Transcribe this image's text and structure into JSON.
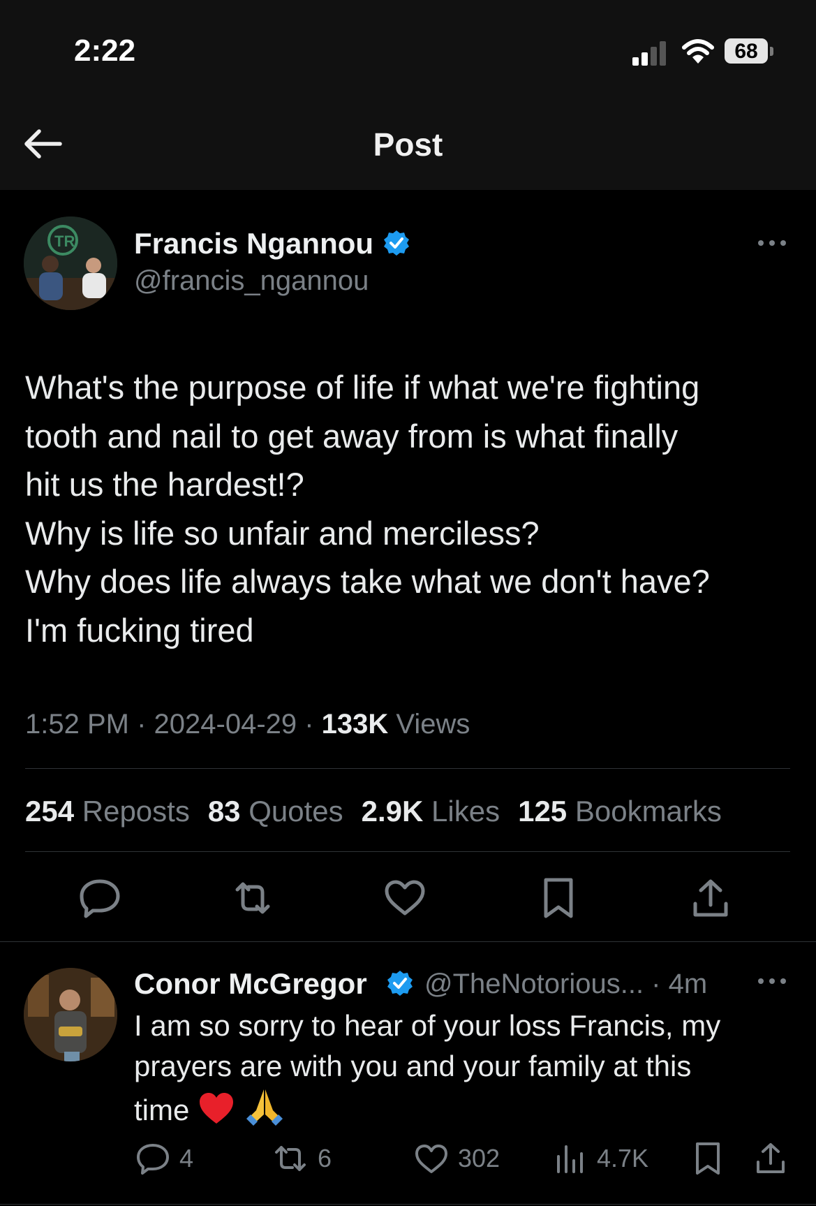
{
  "status_bar": {
    "time": "2:22",
    "battery": "68"
  },
  "header": {
    "title": "Post"
  },
  "post": {
    "author_name": "Francis Ngannou",
    "handle": "@francis_ngannou",
    "text_lines": [
      "What's the purpose of life if what we're fighting",
      "tooth and nail to get away from is what finally",
      "hit us the hardest!?",
      "Why is life so unfair and merciless?",
      "Why does life always take what we don't have?",
      "I'm fucking tired"
    ],
    "time": "1:52 PM",
    "date": "2024-04-29",
    "views_count": "133K",
    "views_label": "Views",
    "stats": {
      "reposts_count": "254",
      "reposts_label": "Reposts",
      "quotes_count": "83",
      "quotes_label": "Quotes",
      "likes_count": "2.9K",
      "likes_label": "Likes",
      "bookmarks_count": "125",
      "bookmarks_label": "Bookmarks"
    },
    "actions": [
      "reply-icon",
      "repost-icon",
      "like-icon",
      "bookmark-icon",
      "share-icon"
    ]
  },
  "reply": {
    "author_name": "Conor McGregor",
    "handle": "@TheNotorious...",
    "time": "4m",
    "text_lines": [
      "I am so sorry to hear of your loss Francis, my",
      "prayers are with you and your family at this",
      "time"
    ],
    "emojis": [
      "red-heart-emoji",
      "folded-hands-emoji"
    ],
    "counts": {
      "replies": "4",
      "reposts": "6",
      "likes": "302",
      "views": "4.7K"
    }
  },
  "colors": {
    "verified": "#1d9bf0",
    "muted": "#7b8187",
    "text": "#e9ebec",
    "background": "#000000",
    "header": "#111111"
  }
}
